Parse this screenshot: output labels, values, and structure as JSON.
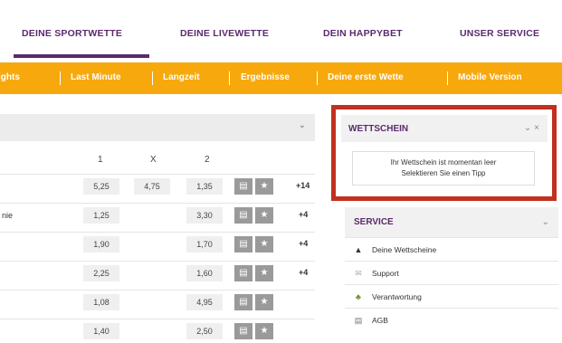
{
  "topnav": {
    "items": [
      "DEINE SPORTWETTE",
      "DEINE LIVEWETTE",
      "DEIN HAPPYBET",
      "UNSER SERVICE"
    ]
  },
  "subnav": {
    "items": [
      "ights",
      "Last Minute",
      "Langzeit",
      "Ergebnisse",
      "Deine erste Wette",
      "Mobile Version"
    ]
  },
  "odds": {
    "col_headers": [
      "1",
      "X",
      "2"
    ],
    "rows": [
      {
        "label": "",
        "o1": "5,25",
        "ox": "4,75",
        "o2": "1,35",
        "more": "+14"
      },
      {
        "label": "nie",
        "o1": "1,25",
        "ox": "",
        "o2": "3,30",
        "more": "+4"
      },
      {
        "label": "",
        "o1": "1,90",
        "ox": "",
        "o2": "1,70",
        "more": "+4"
      },
      {
        "label": "",
        "o1": "2,25",
        "ox": "",
        "o2": "1,60",
        "more": "+4"
      },
      {
        "label": "",
        "o1": "1,08",
        "ox": "",
        "o2": "4,95",
        "more": ""
      },
      {
        "label": "",
        "o1": "1,40",
        "ox": "",
        "o2": "2,50",
        "more": ""
      }
    ],
    "icons": {
      "chevron": "chevron-down-icon",
      "stats": "stats-icon",
      "star": "star-icon"
    }
  },
  "wettschein": {
    "title": "WETTSCHEIN",
    "line1": "Ihr Wettschein ist momentan leer",
    "line2": "Selektieren Sie einen Tipp"
  },
  "service": {
    "title": "SERVICE",
    "items": [
      {
        "label": "Deine Wettscheine",
        "icon": "wettscheine-icon"
      },
      {
        "label": "Support",
        "icon": "support-icon"
      },
      {
        "label": "Verantwortung",
        "icon": "verantwortung-icon"
      },
      {
        "label": "AGB",
        "icon": "agb-icon"
      }
    ]
  },
  "colors": {
    "brand_purple": "#5b2a6e",
    "accent_orange": "#f7a80c",
    "highlight_red": "#c2301f"
  }
}
